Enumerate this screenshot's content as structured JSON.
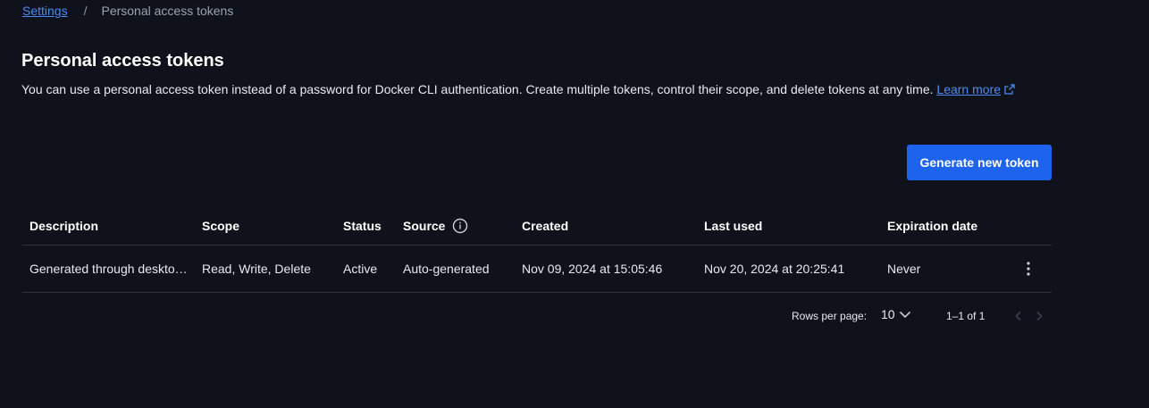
{
  "breadcrumb": {
    "root": "Settings",
    "separator": "/",
    "current": "Personal access tokens"
  },
  "header": {
    "title": "Personal access tokens",
    "description": "You can use a personal access token instead of a password for Docker CLI authentication. Create multiple tokens, control their scope, and delete tokens at any time.",
    "learn_more": "Learn more"
  },
  "actions": {
    "generate_label": "Generate new token"
  },
  "table": {
    "columns": {
      "description": "Description",
      "scope": "Scope",
      "status": "Status",
      "source": "Source",
      "created": "Created",
      "last_used": "Last used",
      "expiration": "Expiration date"
    },
    "rows": [
      {
        "description": "Generated through deskto…",
        "scope": "Read, Write, Delete",
        "status": "Active",
        "source": "Auto-generated",
        "created": "Nov 09, 2024 at 15:05:46",
        "last_used": "Nov 20, 2024 at 20:25:41",
        "expiration": "Never"
      }
    ]
  },
  "pagination": {
    "rows_per_page_label": "Rows per page:",
    "rows_per_page_value": "10",
    "range": "1–1 of 1"
  },
  "icons": {
    "external_link": "external-link-icon",
    "info": "info-icon",
    "row_menu": "more-vertical-icon",
    "dropdown": "chevron-down-icon",
    "prev_page": "chevron-left-icon",
    "next_page": "chevron-right-icon"
  },
  "colors": {
    "background": "#0f121a",
    "link": "#4b8bf5",
    "primary_button": "#1d63ed",
    "divider": "#2c313c"
  }
}
